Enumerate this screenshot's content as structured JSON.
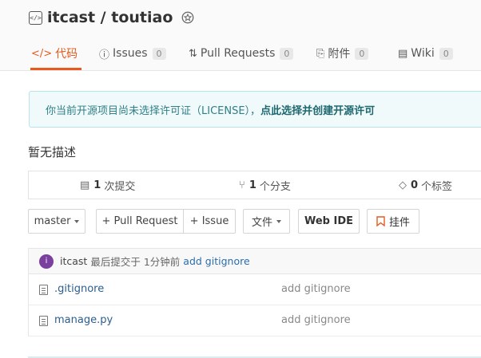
{
  "repo": {
    "title": "itcast / toutiao",
    "icon": "code-repo-icon",
    "badge_icon": "award-badge-icon"
  },
  "tabs": [
    {
      "icon": "</>",
      "label": "代码",
      "count": "",
      "active": true
    },
    {
      "icon": "ⓘ",
      "label": "Issues",
      "count": "0",
      "active": false
    },
    {
      "icon": "⇅",
      "label": "Pull Requests",
      "count": "0",
      "active": false
    },
    {
      "icon": "⎘",
      "label": "附件",
      "count": "0",
      "active": false
    },
    {
      "icon": "▤",
      "label": "Wiki",
      "count": "0",
      "active": false
    }
  ],
  "notice": {
    "text": "你当前开源项目尚未选择许可证（LICENSE），",
    "link": "点此选择并创建开源许可"
  },
  "description": "暂无描述",
  "stats": {
    "commits": {
      "count": "1",
      "label": "次提交"
    },
    "branches": {
      "count": "1",
      "label": "个分支"
    },
    "tags": {
      "count": "0",
      "label": "个标签"
    }
  },
  "toolbar": {
    "branch": "master",
    "pull_request": "+ Pull Request",
    "issue": "+ Issue",
    "files": "文件",
    "web_ide": "Web IDE",
    "widget": "挂件"
  },
  "commit": {
    "avatar_letter": "i",
    "author": "itcast",
    "prefix": "最后提交于",
    "time": "1分钟前",
    "message": "add gitignore"
  },
  "files": [
    {
      "name": ".gitignore",
      "message": "add gitignore"
    },
    {
      "name": "manage.py",
      "message": "add gitignore"
    }
  ],
  "colors": {
    "accent": "#e65a1e",
    "notice_bg": "#f0fafb",
    "avatar": "#7b3fa0",
    "link": "#2b5d8f"
  }
}
